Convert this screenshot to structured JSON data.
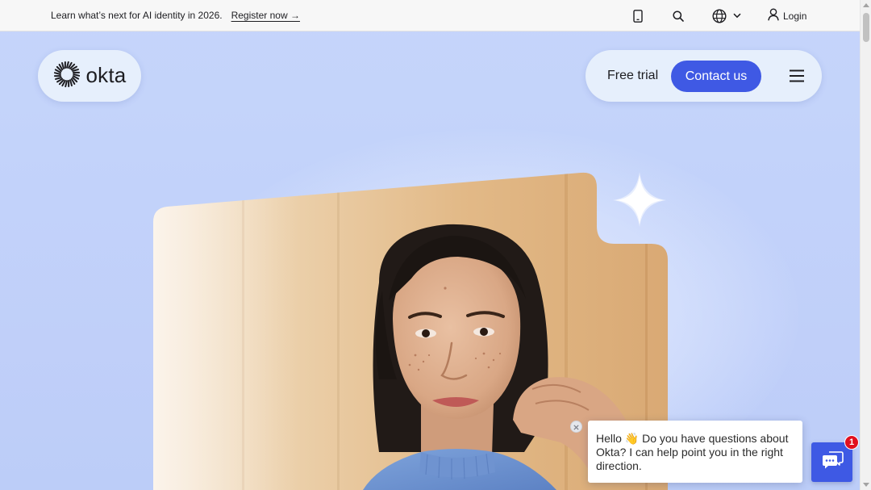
{
  "announcement": {
    "text": "Learn what’s next for AI identity in 2026.",
    "link_label": "Register now →"
  },
  "utility_nav": {
    "mobile_icon": "mobile-phone-icon",
    "search_icon": "search-icon",
    "language_icon": "globe-icon",
    "language_chevron": "chevron-down-icon",
    "login_icon": "user-icon",
    "login_label": "Login"
  },
  "header": {
    "logo_text": "okta",
    "logo_icon": "okta-sunburst-icon",
    "free_trial_label": "Free trial",
    "contact_label": "Contact us",
    "menu_icon": "hamburger-menu-icon"
  },
  "hero": {
    "image_alt": "Portrait of a smiling woman with freckles wearing a blue turtleneck",
    "sparkle_icon": "sparkle-icon"
  },
  "chat": {
    "message": "Hello 👋 Do you have questions about Okta? I can help point you in the right direction.",
    "close_icon": "close-icon",
    "launcher_icon": "chat-bubbles-icon",
    "unread_count": "1"
  },
  "colors": {
    "brand_blue": "#3f59e4",
    "page_background": "#c3d3fa",
    "pill_background": "#e6effc",
    "badge_red": "#e10f1f"
  }
}
